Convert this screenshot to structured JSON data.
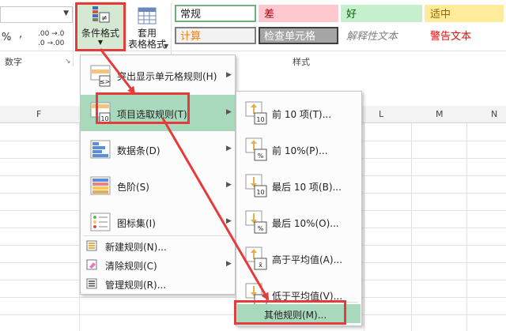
{
  "ribbon": {
    "percent_symbol": "%",
    "comma_symbol": ",",
    "increase_decimal_label": ".00 →.0",
    "decrease_decimal_label": ".0 →.00",
    "number_group_label": "数字",
    "styles_group_label": "样式",
    "conditional_formatting_label": "条件格式",
    "format_table_label_line1": "套用",
    "format_table_label_line2": "表格格式"
  },
  "cell_styles": [
    {
      "name": "常规",
      "bg": "#ffffff",
      "fg": "#222222",
      "border": "#6fb07f"
    },
    {
      "name": "差",
      "bg": "#ffc7ce",
      "fg": "#9c0006",
      "border": "#ffc7ce"
    },
    {
      "name": "好",
      "bg": "#c6efce",
      "fg": "#006100",
      "border": "#c6efce"
    },
    {
      "name": "适中",
      "bg": "#ffeb9c",
      "fg": "#9c6500",
      "border": "#ffeb9c"
    },
    {
      "name": "计算",
      "bg": "#f2f2f2",
      "fg": "#fa7d00",
      "border": "#7f7f7f"
    },
    {
      "name": "检查单元格",
      "bg": "#a5a5a5",
      "fg": "#ffffff",
      "border": "#3f3f3f"
    },
    {
      "name": "解释性文本",
      "bg": "#ffffff",
      "fg": "#7f7f7f",
      "border": "#ffffff"
    },
    {
      "name": "警告文本",
      "bg": "#ffffff",
      "fg": "#ff0000",
      "border": "#ffffff"
    }
  ],
  "columns": [
    "F",
    "L",
    "M",
    "N"
  ],
  "main_menu": {
    "items": [
      {
        "label": "突出显示单元格规则(H)",
        "icon": "highlight-cells-rules-icon",
        "submenu": true
      },
      {
        "label": "项目选取规则(T)",
        "icon": "top-bottom-rules-icon",
        "submenu": true,
        "highlighted": true
      },
      {
        "label": "数据条(D)",
        "icon": "data-bars-icon",
        "submenu": true
      },
      {
        "label": "色阶(S)",
        "icon": "color-scales-icon",
        "submenu": true
      },
      {
        "label": "图标集(I)",
        "icon": "icon-sets-icon",
        "submenu": true
      },
      {
        "label": "新建规则(N)...",
        "icon": "new-rule-icon",
        "submenu": false
      },
      {
        "label": "清除规则(C)",
        "icon": "clear-rules-icon",
        "submenu": true
      },
      {
        "label": "管理规则(R)...",
        "icon": "manage-rules-icon",
        "submenu": false
      }
    ],
    "icon_text_10": "10",
    "icon_text_le": "≤>"
  },
  "sub_menu": {
    "items": [
      {
        "label": "前 10 项(T)...",
        "icon_text": "10"
      },
      {
        "label": "前 10%(P)...",
        "icon_text": "%"
      },
      {
        "label": "最后 10 项(B)...",
        "icon_text": "10"
      },
      {
        "label": "最后 10%(O)...",
        "icon_text": "%"
      },
      {
        "label": "高于平均值(A)...",
        "icon_text": "x̄"
      },
      {
        "label": "低于平均值(V)..."
      }
    ],
    "more_rules_label": "其他规则(M)..."
  },
  "colors": {
    "highlight": "#a9d9bc",
    "annotation_red": "#e63b3b",
    "ribbon_active": "#d5e8d4"
  }
}
